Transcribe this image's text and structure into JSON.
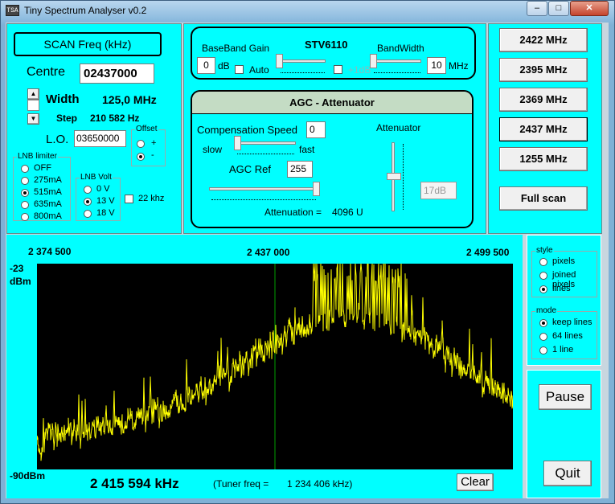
{
  "window": {
    "title": "Tiny Spectrum Analyser v0.2",
    "icon_label": "TSA",
    "minimize": "–",
    "maximize": "□",
    "close": "✕"
  },
  "scan": {
    "header": "SCAN Freq (kHz)",
    "centre_label": "Centre",
    "centre_value": "02437000",
    "width_label": "Width",
    "width_value": "125,0 MHz",
    "step_label": "Step",
    "step_value": "210 582 Hz",
    "lo_label": "L.O.",
    "lo_value": "03650000",
    "offset_title": "Offset",
    "offset_plus": "+",
    "offset_minus": "-",
    "lnb_limiter_title": "LNB limiter",
    "lnb_limiter_options": [
      "OFF",
      "275mA",
      "515mA",
      "635mA",
      "800mA"
    ],
    "lnb_volt_title": "LNB Volt",
    "lnb_volt_options": [
      "0 V",
      "13 V",
      "18 V"
    ],
    "khz22_label": "22 khz"
  },
  "tuner": {
    "chip": "STV6110",
    "baseband_label": "BaseBand Gain",
    "baseband_value": "0",
    "baseband_unit": "dB",
    "auto_label": "Auto",
    "plus1db_label": "+1dB",
    "bandwidth_label": "BandWidth",
    "bandwidth_value": "10",
    "bandwidth_unit": "MHz"
  },
  "agc": {
    "title": "AGC - Attenuator",
    "comp_speed_label": "Compensation Speed",
    "comp_speed_value": "0",
    "slow_label": "slow",
    "fast_label": "fast",
    "agc_ref_label": "AGC Ref",
    "agc_ref_value": "255",
    "attenuator_label": "Attenuator",
    "attenuator_value": "17dB",
    "attenuation_label": "Attenuation =",
    "attenuation_value": "4096 U"
  },
  "presets": [
    "2422 MHz",
    "2395 MHz",
    "2369 MHz",
    "2437 MHz",
    "1255 MHz"
  ],
  "full_scan_label": "Full scan",
  "spectrum": {
    "freq_left": "2 374 500",
    "freq_center": "2 437 000",
    "freq_right": "2 499 500",
    "top_db": "-23",
    "top_db_unit": "dBm",
    "bottom_db": "-90dBm",
    "cursor_freq": "2 415 594 kHz",
    "tuner_freq_label": "(Tuner freq =",
    "tuner_freq_value": "1 234 406 kHz)",
    "clear_label": "Clear",
    "trace_color": "#ffff00",
    "marker_color": "#00a000"
  },
  "style_group": {
    "title": "style",
    "options": [
      "pixels",
      "joined pixels",
      "lines"
    ]
  },
  "mode_group": {
    "title": "mode",
    "options": [
      "keep lines",
      "64 lines",
      "1 line"
    ]
  },
  "pause_label": "Pause",
  "quit_label": "Quit"
}
